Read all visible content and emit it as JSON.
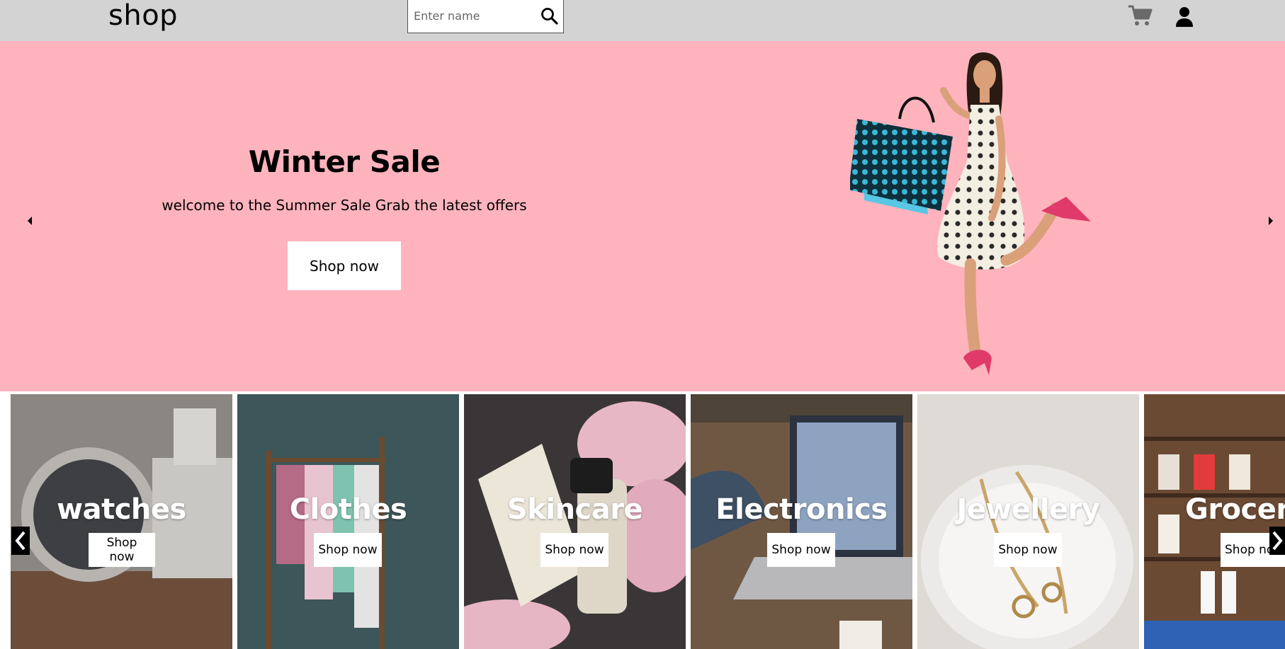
{
  "header": {
    "logo": "shop",
    "search_placeholder": "Enter name",
    "icons": {
      "search": "search-icon",
      "cart": "cart-icon",
      "user": "user-icon"
    },
    "background": "#d3d3d3"
  },
  "hero": {
    "title": "Winter Sale",
    "subtitle": "welcome to the Summer Sale Grab the latest offers",
    "button_label": "Shop now",
    "background": "#ffb3bd"
  },
  "categories": [
    {
      "title": "watches",
      "button_label": "Shop now"
    },
    {
      "title": "Clothes",
      "button_label": "Shop now"
    },
    {
      "title": "Skincare",
      "button_label": "Shop now"
    },
    {
      "title": "Electronics",
      "button_label": "Shop now"
    },
    {
      "title": "Jewellery",
      "button_label": "Shop now"
    },
    {
      "title": "Grocer",
      "button_label": "Shop no"
    }
  ]
}
